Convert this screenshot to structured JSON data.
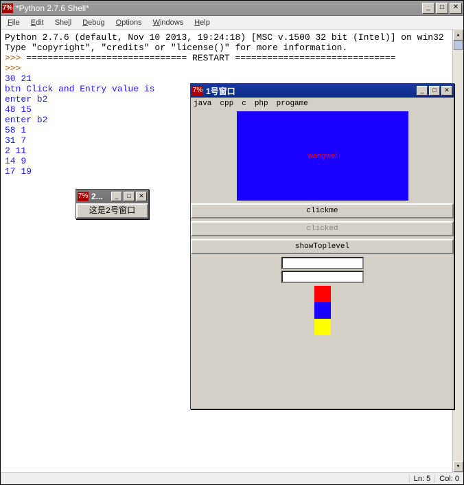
{
  "main_window": {
    "title": "*Python 2.7.6 Shell*",
    "menus": [
      "File",
      "Edit",
      "Shell",
      "Debug",
      "Options",
      "Windows",
      "Help"
    ]
  },
  "shell_output": {
    "banner": "Python 2.7.6 (default, Nov 10 2013, 19:24:18) [MSC v.1500 32 bit (Intel)] on win32",
    "hint": "Type \"copyright\", \"credits\" or \"license()\" for more information.",
    "restart_prefix": ">>> ",
    "restart_line": "============================== RESTART ==============================",
    "prompt": ">>> ",
    "lines": [
      "30 21",
      "btn Click and Entry value is",
      "enter b2",
      "48 15",
      "enter b2",
      "58 1",
      "31 7",
      "2 11",
      "14 9",
      "17 19"
    ]
  },
  "statusbar": {
    "line_label": "Ln: ",
    "line_value": "5",
    "col_label": "Col: ",
    "col_value": "0"
  },
  "window1": {
    "title": "1号窗口",
    "menus": [
      "java",
      "cpp",
      "c",
      "php",
      "progame"
    ],
    "canvas_text": "wangwei",
    "button_clickme": "clickme",
    "button_clicked": "clicked",
    "button_showtoplevel": "showToplevel",
    "colors": [
      "#ff0000",
      "#1a00ff",
      "#ffff00"
    ]
  },
  "window2": {
    "title_short": "2...",
    "button_label": "这是2号窗口"
  },
  "win_controls": {
    "minimize": "_",
    "maximize": "□",
    "close": "✕"
  }
}
